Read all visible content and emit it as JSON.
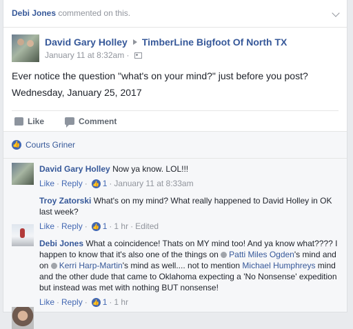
{
  "notice": {
    "actor": "Debi Jones",
    "action": "commented on this."
  },
  "post": {
    "author": "David Gary Holley",
    "group": "TimberLine Bigfoot Of North TX",
    "timestamp": "January 11 at 8:32am",
    "separator": "·",
    "body_line1": "Ever notice the question \"what's on your mind?\" just before you post?",
    "body_line2": "Wednesday, January 25, 2017"
  },
  "actions": {
    "like": "Like",
    "comment": "Comment"
  },
  "likes": {
    "name": "Courts Griner"
  },
  "comments": [
    {
      "author": "David Gary Holley",
      "text": "Now ya know. LOL!!!",
      "like": "Like",
      "reply": "Reply",
      "dot": "·",
      "like_count": "1",
      "time": "January 11 at 8:33am"
    },
    {
      "author": "Troy Zatorski",
      "text": "What's on my mind? What really happened to David Holley in OK last week?",
      "like": "Like",
      "reply": "Reply",
      "dot": "·",
      "like_count": "1",
      "time": "1 hr",
      "edited": "Edited"
    },
    {
      "author": "Debi Jones",
      "text_a": "What a coincidence! Thats on MY mind too! And ya know what???? I happen to know that it's also one of the things on ",
      "tag1": "Patti Miles Ogden",
      "text_b": "'s mind and on ",
      "tag2": "Kerri Harp-Martin",
      "text_c": "'s mind as well.... not to mention ",
      "tag3": "Michael Humphreys",
      "text_d": " mind and the other dude that came to Oklahoma expecting a 'No Nonsense' expedition but instead was met with nothing BUT nonsense!",
      "like": "Like",
      "reply": "Reply",
      "dot": "·",
      "like_count": "1",
      "time": "1 hr"
    }
  ]
}
